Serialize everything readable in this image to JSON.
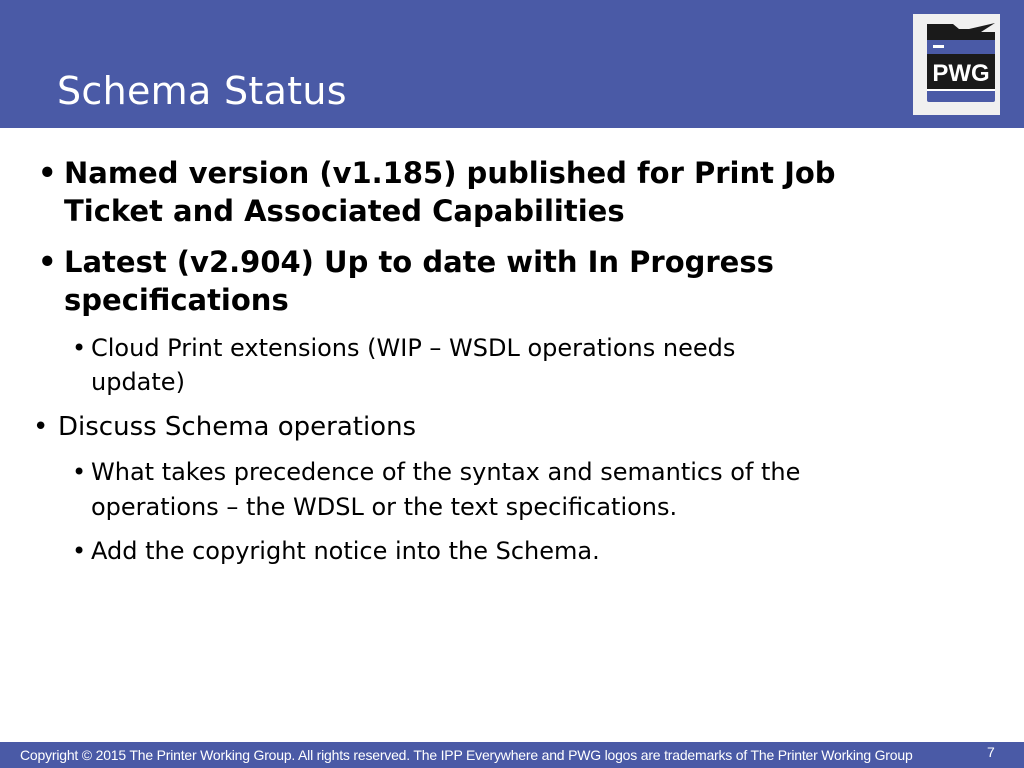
{
  "header": {
    "title": "Schema Status",
    "logo_text": "PWG"
  },
  "bullets": [
    {
      "level": 1,
      "lines": [
        "Named version (v1.185) published for Print Job",
        "Ticket and Associated Capabilities"
      ]
    },
    {
      "level": 1,
      "lines": [
        "Latest (v2.904) Up to date with In Progress",
        "specifications"
      ]
    },
    {
      "level": 2,
      "lines": [
        "Cloud Print extensions (WIP – WSDL operations needs",
        "update)"
      ]
    },
    {
      "level": 1,
      "lines": [
        "Discuss Schema operations"
      ]
    },
    {
      "level": 2,
      "lines": [
        "What takes precedence of the syntax and semantics of the",
        "operations – the WDSL or the text specifications."
      ]
    },
    {
      "level": 2,
      "lines": [
        "Add the copyright notice into the Schema."
      ]
    }
  ],
  "bullet_glyph": "•",
  "footer": {
    "copyright": "Copyright © 2015 The Printer Working Group. All rights reserved. The IPP Everywhere and PWG logos are trademarks of The Printer Working Group",
    "page_number": "7"
  },
  "colors": {
    "brand_blue": "#4a5aa6",
    "logo_dark": "#1a1a1a",
    "logo_background": "#f0f0f0"
  }
}
